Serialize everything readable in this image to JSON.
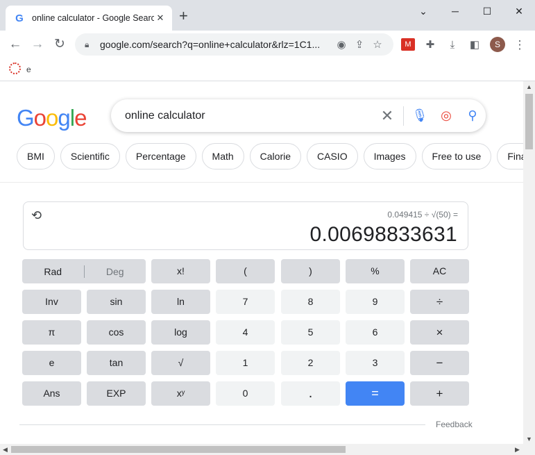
{
  "browser": {
    "tab_title": "online calculator - Google Search",
    "tab_close": "✕",
    "new_tab": "+",
    "window": {
      "minimize": "⌄",
      "min2": "─",
      "maximize": "☐",
      "close": "✕"
    },
    "url": "google.com/search?q=online+calculator&rlz=1C1...",
    "bookmark_label": "e",
    "avatar_letter": "S"
  },
  "search": {
    "logo": [
      "G",
      "o",
      "o",
      "g",
      "l",
      "e"
    ],
    "logo_colors": [
      "#4285f4",
      "#ea4335",
      "#fbbc05",
      "#4285f4",
      "#34a853",
      "#ea4335"
    ],
    "query": "online calculator",
    "chips": [
      "BMI",
      "Scientific",
      "Percentage",
      "Math",
      "Calorie",
      "CASIO",
      "Images",
      "Free to use",
      "Finance"
    ]
  },
  "calculator": {
    "expression": "0.049415 ÷ √(50) =",
    "result": "0.00698833631",
    "rad": "Rad",
    "deg": "Deg",
    "keys": {
      "fact": "x!",
      "lparen": "(",
      "rparen": ")",
      "percent": "%",
      "ac": "AC",
      "inv": "Inv",
      "sin": "sin",
      "ln": "ln",
      "k7": "7",
      "k8": "8",
      "k9": "9",
      "divide": "÷",
      "pi": "π",
      "cos": "cos",
      "log": "log",
      "k4": "4",
      "k5": "5",
      "k6": "6",
      "multiply": "×",
      "e": "e",
      "tan": "tan",
      "sqrt": "√",
      "k1": "1",
      "k2": "2",
      "k3": "3",
      "minus": "−",
      "ans": "Ans",
      "exp": "EXP",
      "pow": "xʸ",
      "k0": "0",
      "dot": ".",
      "equals": "=",
      "plus": "+"
    },
    "feedback": "Feedback"
  }
}
